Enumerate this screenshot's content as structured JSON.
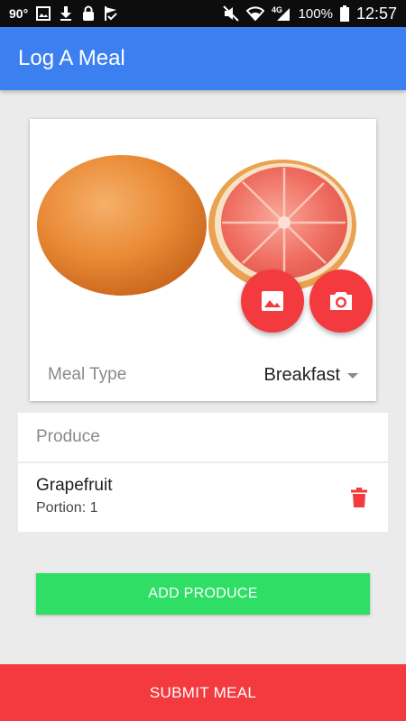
{
  "status_bar": {
    "temperature": "90°",
    "network": "4G",
    "battery_percent": "100%",
    "time": "12:57",
    "left_icons": [
      "image-icon",
      "download-icon",
      "lock-icon",
      "check-flag-icon"
    ],
    "right_icons": [
      "mute-icon",
      "wifi-icon",
      "signal-icon",
      "battery-icon"
    ]
  },
  "app_bar": {
    "title": "Log A Meal",
    "color": "#3b7ff0"
  },
  "meal_card": {
    "image_subject": "grapefruit",
    "gallery_icon": "image-icon",
    "camera_icon": "camera-icon",
    "meal_type_label": "Meal Type",
    "meal_type_value": "Breakfast"
  },
  "produce": {
    "header": "Produce",
    "items": [
      {
        "name": "Grapefruit",
        "portion": "Portion: 1"
      }
    ]
  },
  "buttons": {
    "add_produce": "ADD PRODUCE",
    "submit_meal": "SUBMIT MEAL"
  },
  "colors": {
    "accent_red": "#f23a3f",
    "add_green": "#2fde65",
    "background": "#ebebeb"
  }
}
